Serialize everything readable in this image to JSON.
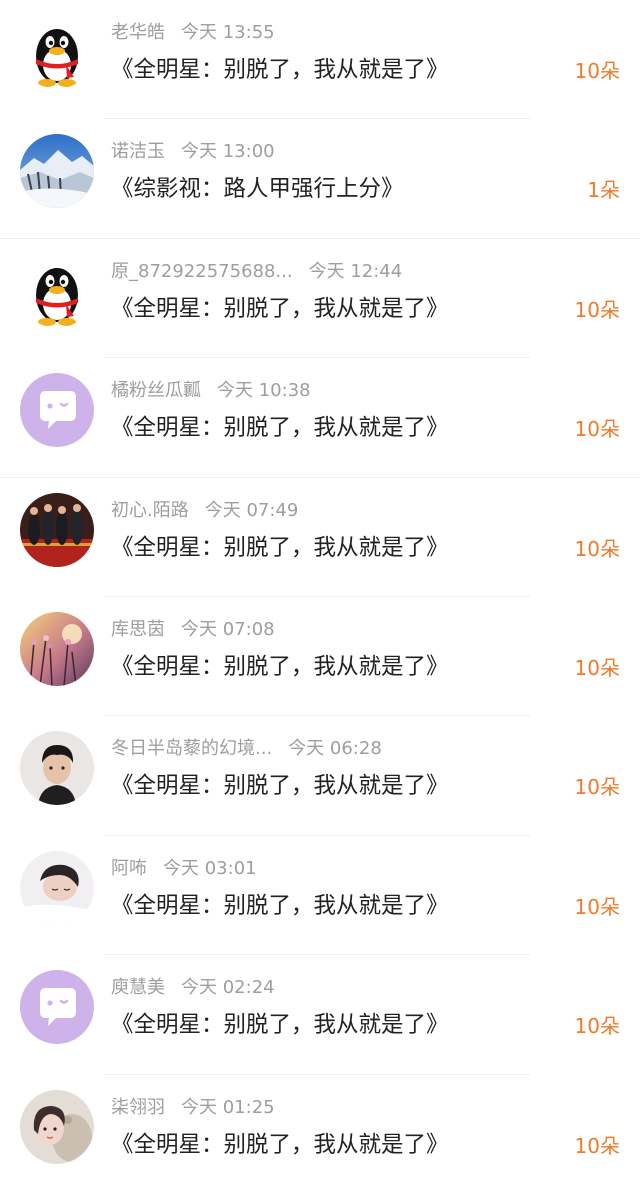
{
  "gift_records": [
    {
      "username": "老华皓",
      "time": "今天 13:55",
      "gift_title": "《全明星：别脱了，我从就是了》",
      "count": "10朵",
      "avatar": "qq-penguin-icon"
    },
    {
      "username": "诺洁玉",
      "time": "今天 13:00",
      "gift_title": "《综影视：路人甲强行上分》",
      "count": "1朵",
      "avatar": "snowy-mountain-photo"
    },
    {
      "username": "原_872922575688...",
      "time": "今天 12:44",
      "gift_title": "《全明星：别脱了，我从就是了》",
      "count": "10朵",
      "avatar": "qq-penguin-icon"
    },
    {
      "username": "橘粉丝瓜瓤",
      "time": "今天 10:38",
      "gift_title": "《全明星：别脱了，我从就是了》",
      "count": "10朵",
      "avatar": "chat-bubble-icon"
    },
    {
      "username": "初心.陌路",
      "time": "今天 07:49",
      "gift_title": "《全明星：别脱了，我从就是了》",
      "count": "10朵",
      "avatar": "stage-group-photo"
    },
    {
      "username": "库思茵",
      "time": "今天 07:08",
      "gift_title": "《全明星：别脱了，我从就是了》",
      "count": "10朵",
      "avatar": "sunset-flowers-photo"
    },
    {
      "username": "冬日半岛藜的幻境...",
      "time": "今天 06:28",
      "gift_title": "《全明星：别脱了，我从就是了》",
      "count": "10朵",
      "avatar": "young-man-portrait"
    },
    {
      "username": "阿咘",
      "time": "今天 03:01",
      "gift_title": "《全明星：别脱了，我从就是了》",
      "count": "10朵",
      "avatar": "sleeping-person-portrait"
    },
    {
      "username": "庾慧美",
      "time": "今天 02:24",
      "gift_title": "《全明星：别脱了，我从就是了》",
      "count": "10朵",
      "avatar": "chat-bubble-icon"
    },
    {
      "username": "柒翎羽",
      "time": "今天 01:25",
      "gift_title": "《全明星：别脱了，我从就是了》",
      "count": "10朵",
      "avatar": "girl-with-plush-portrait"
    }
  ],
  "colors": {
    "username": "#9e9e9e",
    "title": "#222222",
    "count": "#f07a2a",
    "divider": "#eeeeee",
    "bubble_avatar_bg": "#cdb3ea"
  }
}
